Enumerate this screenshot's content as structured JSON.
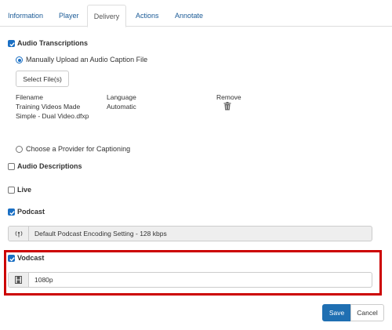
{
  "tabs": [
    {
      "label": "Information",
      "active": false
    },
    {
      "label": "Player",
      "active": false
    },
    {
      "label": "Delivery",
      "active": true
    },
    {
      "label": "Actions",
      "active": false
    },
    {
      "label": "Annotate",
      "active": false
    }
  ],
  "audio_transcriptions": {
    "label": "Audio Transcriptions",
    "checked": true,
    "manual_upload": {
      "label": "Manually Upload an Audio Caption File",
      "selected": true
    },
    "select_files_label": "Select File(s)",
    "file_table": {
      "headers": {
        "filename": "Filename",
        "language": "Language",
        "remove": "Remove"
      },
      "rows": [
        {
          "filename_line1": "Training Videos Made",
          "filename_line2": "Simple - Dual Video.dfxp",
          "language": "Automatic",
          "remove_icon": "trash-icon"
        }
      ]
    },
    "provider": {
      "label": "Choose a Provider for Captioning",
      "selected": false
    }
  },
  "audio_descriptions": {
    "label": "Audio Descriptions",
    "checked": false
  },
  "live": {
    "label": "Live",
    "checked": false
  },
  "podcast": {
    "label": "Podcast",
    "checked": true,
    "icon": "podcast-antenna-icon",
    "value": "Default Podcast Encoding Setting - 128 kbps",
    "disabled": true
  },
  "vodcast": {
    "label": "Vodcast",
    "checked": true,
    "icon": "film-icon",
    "value": "1080p"
  },
  "buttons": {
    "save": "Save",
    "cancel": "Cancel"
  },
  "colors": {
    "accent": "#1a6fc4",
    "link": "#1a5a96",
    "highlight": "#cc0000",
    "save_bg": "#1f6fb2"
  }
}
